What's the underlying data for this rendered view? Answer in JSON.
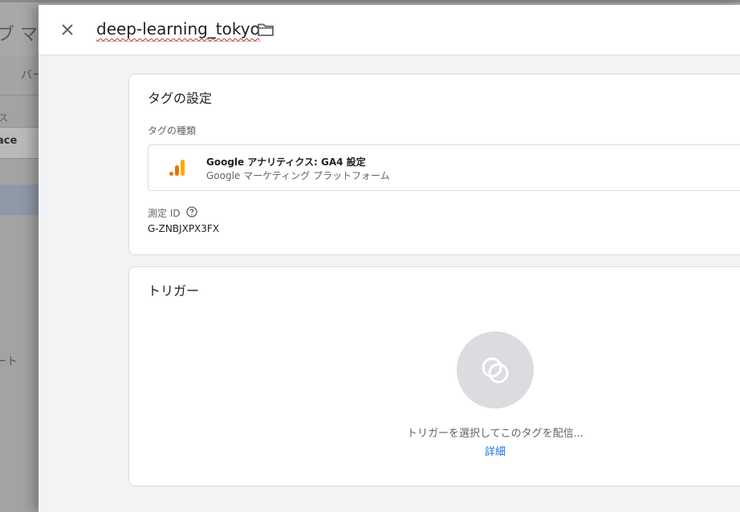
{
  "background": {
    "title": "ブ マネ",
    "tab": "バー",
    "workspace_label": "ス",
    "workspace_name": "ace",
    "nav_item": "ート"
  },
  "header": {
    "tag_name": "deep-learning_tokyo",
    "close_icon": "close-icon",
    "folder_icon": "folder-icon"
  },
  "tag_config": {
    "title": "タグの設定",
    "type_label": "タグの種類",
    "type_name": "Google アナリティクス: GA4 設定",
    "type_subtitle": "Google マーケティング プラットフォーム",
    "type_icon": "google-analytics-icon",
    "measurement_label": "測定 ID",
    "measurement_help_icon": "help-circle-icon",
    "measurement_value": "G-ZNBJXPX3FX"
  },
  "trigger": {
    "title": "トリガー",
    "hint": "トリガーを選択してこのタグを配信...",
    "link": "詳細",
    "icon": "trigger-circles-icon"
  },
  "colors": {
    "accent": "#1a73e8",
    "ga_orange": "#f9ab00",
    "ga_dark_orange": "#e37400",
    "panel_bg": "#f1f3f4"
  }
}
